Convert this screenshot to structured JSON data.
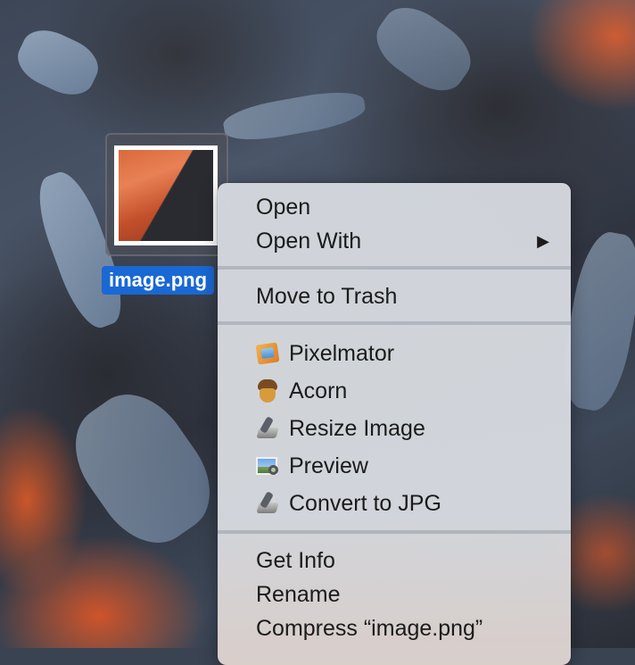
{
  "desktop": {
    "file": {
      "label": "image.png"
    }
  },
  "context_menu": {
    "open_label": "Open",
    "open_with_label": "Open With",
    "open_with_arrow": "▶",
    "move_to_trash_label": "Move to Trash",
    "apps": [
      {
        "label": "Pixelmator",
        "icon": "pixelmator-icon"
      },
      {
        "label": "Acorn",
        "icon": "acorn-icon"
      },
      {
        "label": "Resize Image",
        "icon": "automator-icon"
      },
      {
        "label": "Preview",
        "icon": "preview-icon"
      },
      {
        "label": "Convert to JPG",
        "icon": "automator-icon"
      }
    ],
    "get_info_label": "Get Info",
    "rename_label": "Rename",
    "compress_label": "Compress “image.png”"
  },
  "colors": {
    "selection_blue": "#1a68d3",
    "menu_bg": "#d4d8de",
    "text": "#1b1b1b"
  }
}
